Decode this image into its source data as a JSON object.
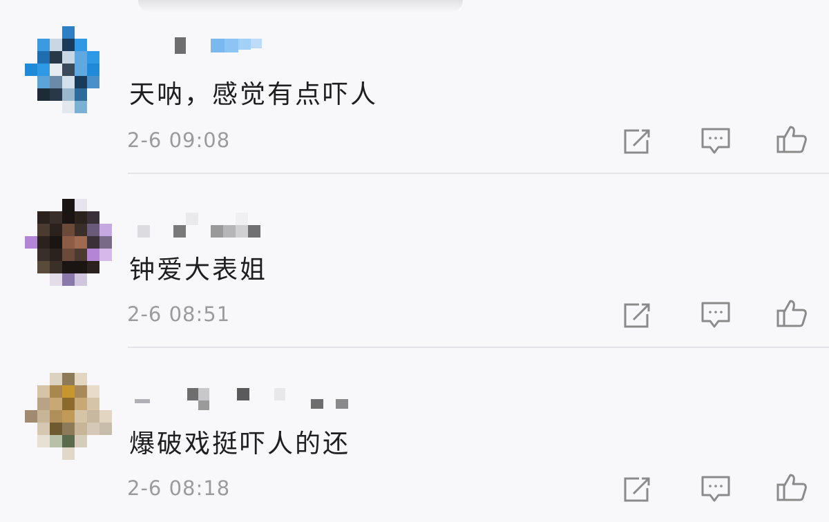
{
  "comments": [
    {
      "text": "天呐，感觉有点吓人",
      "time": "2-6 09:08",
      "avatar_palette": [
        "#1f8ad8",
        "#2e9ae6",
        "#1a3a5a",
        "#c9d7e4",
        "#5fa9e0",
        "#283848"
      ],
      "actions": {
        "share_icon": "share-icon",
        "reply_icon": "comment-icon",
        "like_icon": "thumbs-up-icon"
      }
    },
    {
      "text": "钟爱大表姐",
      "time": "2-6 08:51",
      "avatar_palette": [
        "#2b221d",
        "#4b3a30",
        "#8c5c47",
        "#b485d6",
        "#1a1412",
        "#7a6a8a"
      ],
      "actions": {
        "share_icon": "share-icon",
        "reply_icon": "comment-icon",
        "like_icon": "thumbs-up-icon"
      }
    },
    {
      "text": "爆破戏挺吓人的还",
      "time": "2-6 08:18",
      "avatar_palette": [
        "#c8a874",
        "#a8884e",
        "#6e5a30",
        "#d6c4a6",
        "#8c7a58",
        "#e2d6c2"
      ],
      "actions": {
        "share_icon": "share-icon",
        "reply_icon": "comment-icon",
        "like_icon": "thumbs-up-icon"
      }
    }
  ],
  "colors": {
    "background": "#f8f8fb",
    "text": "#1e1e1e",
    "timestamp": "#9b9b9b",
    "icon": "#8a8a8a",
    "divider": "#e4e4e8"
  }
}
